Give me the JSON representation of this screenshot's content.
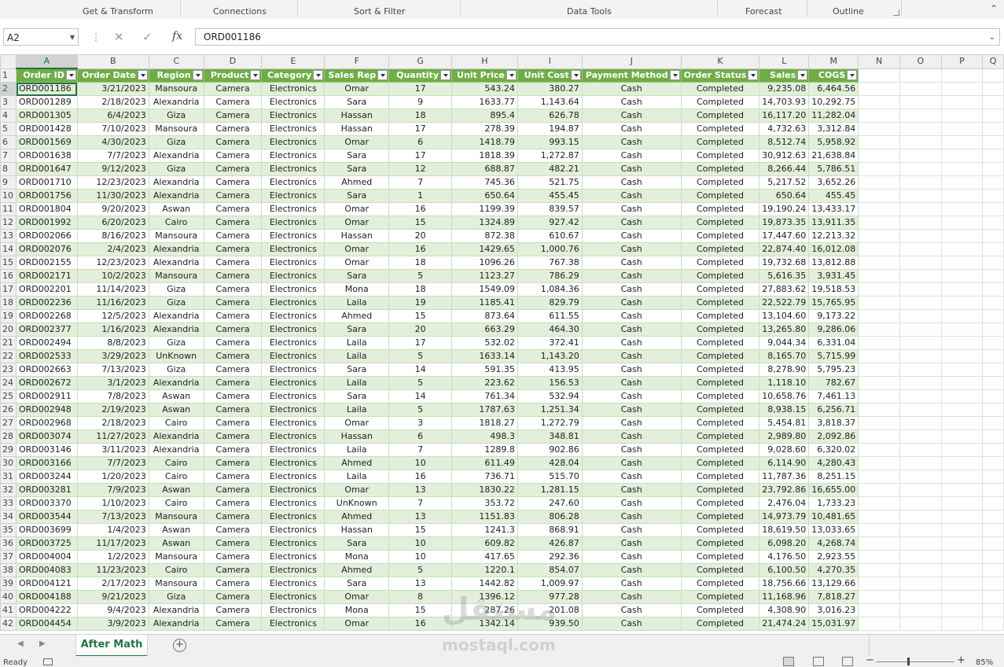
{
  "ribbon": {
    "groups": [
      "Get & Transform",
      "Connections",
      "Sort & Filter",
      "Data Tools",
      "Forecast",
      "Outline"
    ]
  },
  "formula_bar": {
    "name_box": "A2",
    "cancel_icon": "✕",
    "enter_icon": "✓",
    "fx_label": "fx",
    "formula": "ORD001186"
  },
  "columns": [
    "A",
    "B",
    "C",
    "D",
    "E",
    "F",
    "G",
    "H",
    "I",
    "J",
    "K",
    "L",
    "M",
    "N",
    "O",
    "P",
    "Q"
  ],
  "headers": [
    "Order ID",
    "Order Date",
    "Region",
    "Product",
    "Category",
    "Sales Rep",
    "Quantity",
    "Unit Price",
    "Unit Cost",
    "Payment Method",
    "Order Status",
    "Sales",
    "COGS"
  ],
  "rows": [
    [
      "2",
      "ORD001186",
      "3/21/2023",
      "Mansoura",
      "Camera",
      "Electronics",
      "Omar",
      "17",
      "543.24",
      "380.27",
      "Cash",
      "Completed",
      "9,235.08",
      "6,464.56"
    ],
    [
      "3",
      "ORD001289",
      "2/18/2023",
      "Alexandria",
      "Camera",
      "Electronics",
      "Sara",
      "9",
      "1633.77",
      "1,143.64",
      "Cash",
      "Completed",
      "14,703.93",
      "10,292.75"
    ],
    [
      "4",
      "ORD001305",
      "6/4/2023",
      "Giza",
      "Camera",
      "Electronics",
      "Hassan",
      "18",
      "895.4",
      "626.78",
      "Cash",
      "Completed",
      "16,117.20",
      "11,282.04"
    ],
    [
      "5",
      "ORD001428",
      "7/10/2023",
      "Mansoura",
      "Camera",
      "Electronics",
      "Hassan",
      "17",
      "278.39",
      "194.87",
      "Cash",
      "Completed",
      "4,732.63",
      "3,312.84"
    ],
    [
      "6",
      "ORD001569",
      "4/30/2023",
      "Giza",
      "Camera",
      "Electronics",
      "Omar",
      "6",
      "1418.79",
      "993.15",
      "Cash",
      "Completed",
      "8,512.74",
      "5,958.92"
    ],
    [
      "7",
      "ORD001638",
      "7/7/2023",
      "Alexandria",
      "Camera",
      "Electronics",
      "Sara",
      "17",
      "1818.39",
      "1,272.87",
      "Cash",
      "Completed",
      "30,912.63",
      "21,638.84"
    ],
    [
      "8",
      "ORD001647",
      "9/12/2023",
      "Giza",
      "Camera",
      "Electronics",
      "Sara",
      "12",
      "688.87",
      "482.21",
      "Cash",
      "Completed",
      "8,266.44",
      "5,786.51"
    ],
    [
      "9",
      "ORD001710",
      "12/23/2023",
      "Alexandria",
      "Camera",
      "Electronics",
      "Ahmed",
      "7",
      "745.36",
      "521.75",
      "Cash",
      "Completed",
      "5,217.52",
      "3,652.26"
    ],
    [
      "10",
      "ORD001756",
      "11/30/2023",
      "Alexandria",
      "Camera",
      "Electronics",
      "Sara",
      "1",
      "650.64",
      "455.45",
      "Cash",
      "Completed",
      "650.64",
      "455.45"
    ],
    [
      "11",
      "ORD001804",
      "9/20/2023",
      "Aswan",
      "Camera",
      "Electronics",
      "Omar",
      "16",
      "1199.39",
      "839.57",
      "Cash",
      "Completed",
      "19,190.24",
      "13,433.17"
    ],
    [
      "12",
      "ORD001992",
      "6/20/2023",
      "Cairo",
      "Camera",
      "Electronics",
      "Omar",
      "15",
      "1324.89",
      "927.42",
      "Cash",
      "Completed",
      "19,873.35",
      "13,911.35"
    ],
    [
      "13",
      "ORD002066",
      "8/16/2023",
      "Mansoura",
      "Camera",
      "Electronics",
      "Hassan",
      "20",
      "872.38",
      "610.67",
      "Cash",
      "Completed",
      "17,447.60",
      "12,213.32"
    ],
    [
      "14",
      "ORD002076",
      "2/4/2023",
      "Alexandria",
      "Camera",
      "Electronics",
      "Omar",
      "16",
      "1429.65",
      "1,000.76",
      "Cash",
      "Completed",
      "22,874.40",
      "16,012.08"
    ],
    [
      "15",
      "ORD002155",
      "12/23/2023",
      "Alexandria",
      "Camera",
      "Electronics",
      "Omar",
      "18",
      "1096.26",
      "767.38",
      "Cash",
      "Completed",
      "19,732.68",
      "13,812.88"
    ],
    [
      "16",
      "ORD002171",
      "10/2/2023",
      "Mansoura",
      "Camera",
      "Electronics",
      "Sara",
      "5",
      "1123.27",
      "786.29",
      "Cash",
      "Completed",
      "5,616.35",
      "3,931.45"
    ],
    [
      "17",
      "ORD002201",
      "11/14/2023",
      "Giza",
      "Camera",
      "Electronics",
      "Mona",
      "18",
      "1549.09",
      "1,084.36",
      "Cash",
      "Completed",
      "27,883.62",
      "19,518.53"
    ],
    [
      "18",
      "ORD002236",
      "11/16/2023",
      "Giza",
      "Camera",
      "Electronics",
      "Laila",
      "19",
      "1185.41",
      "829.79",
      "Cash",
      "Completed",
      "22,522.79",
      "15,765.95"
    ],
    [
      "19",
      "ORD002268",
      "12/5/2023",
      "Alexandria",
      "Camera",
      "Electronics",
      "Ahmed",
      "15",
      "873.64",
      "611.55",
      "Cash",
      "Completed",
      "13,104.60",
      "9,173.22"
    ],
    [
      "20",
      "ORD002377",
      "1/16/2023",
      "Alexandria",
      "Camera",
      "Electronics",
      "Sara",
      "20",
      "663.29",
      "464.30",
      "Cash",
      "Completed",
      "13,265.80",
      "9,286.06"
    ],
    [
      "21",
      "ORD002494",
      "8/8/2023",
      "Giza",
      "Camera",
      "Electronics",
      "Laila",
      "17",
      "532.02",
      "372.41",
      "Cash",
      "Completed",
      "9,044.34",
      "6,331.04"
    ],
    [
      "22",
      "ORD002533",
      "3/29/2023",
      "UnKnown",
      "Camera",
      "Electronics",
      "Laila",
      "5",
      "1633.14",
      "1,143.20",
      "Cash",
      "Completed",
      "8,165.70",
      "5,715.99"
    ],
    [
      "23",
      "ORD002663",
      "7/13/2023",
      "Giza",
      "Camera",
      "Electronics",
      "Sara",
      "14",
      "591.35",
      "413.95",
      "Cash",
      "Completed",
      "8,278.90",
      "5,795.23"
    ],
    [
      "24",
      "ORD002672",
      "3/1/2023",
      "Alexandria",
      "Camera",
      "Electronics",
      "Laila",
      "5",
      "223.62",
      "156.53",
      "Cash",
      "Completed",
      "1,118.10",
      "782.67"
    ],
    [
      "25",
      "ORD002911",
      "7/8/2023",
      "Aswan",
      "Camera",
      "Electronics",
      "Sara",
      "14",
      "761.34",
      "532.94",
      "Cash",
      "Completed",
      "10,658.76",
      "7,461.13"
    ],
    [
      "26",
      "ORD002948",
      "2/19/2023",
      "Aswan",
      "Camera",
      "Electronics",
      "Laila",
      "5",
      "1787.63",
      "1,251.34",
      "Cash",
      "Completed",
      "8,938.15",
      "6,256.71"
    ],
    [
      "27",
      "ORD002968",
      "2/18/2023",
      "Cairo",
      "Camera",
      "Electronics",
      "Omar",
      "3",
      "1818.27",
      "1,272.79",
      "Cash",
      "Completed",
      "5,454.81",
      "3,818.37"
    ],
    [
      "28",
      "ORD003074",
      "11/27/2023",
      "Alexandria",
      "Camera",
      "Electronics",
      "Hassan",
      "6",
      "498.3",
      "348.81",
      "Cash",
      "Completed",
      "2,989.80",
      "2,092.86"
    ],
    [
      "29",
      "ORD003146",
      "3/11/2023",
      "Alexandria",
      "Camera",
      "Electronics",
      "Laila",
      "7",
      "1289.8",
      "902.86",
      "Cash",
      "Completed",
      "9,028.60",
      "6,320.02"
    ],
    [
      "30",
      "ORD003166",
      "7/7/2023",
      "Cairo",
      "Camera",
      "Electronics",
      "Ahmed",
      "10",
      "611.49",
      "428.04",
      "Cash",
      "Completed",
      "6,114.90",
      "4,280.43"
    ],
    [
      "31",
      "ORD003244",
      "1/20/2023",
      "Cairo",
      "Camera",
      "Electronics",
      "Laila",
      "16",
      "736.71",
      "515.70",
      "Cash",
      "Completed",
      "11,787.36",
      "8,251.15"
    ],
    [
      "32",
      "ORD003281",
      "7/9/2023",
      "Aswan",
      "Camera",
      "Electronics",
      "Omar",
      "13",
      "1830.22",
      "1,281.15",
      "Cash",
      "Completed",
      "23,792.86",
      "16,655.00"
    ],
    [
      "33",
      "ORD003370",
      "1/10/2023",
      "Cairo",
      "Camera",
      "Electronics",
      "UnKnown",
      "7",
      "353.72",
      "247.60",
      "Cash",
      "Completed",
      "2,476.04",
      "1,733.23"
    ],
    [
      "34",
      "ORD003544",
      "7/13/2023",
      "Mansoura",
      "Camera",
      "Electronics",
      "Ahmed",
      "13",
      "1151.83",
      "806.28",
      "Cash",
      "Completed",
      "14,973.79",
      "10,481.65"
    ],
    [
      "35",
      "ORD003699",
      "1/4/2023",
      "Aswan",
      "Camera",
      "Electronics",
      "Hassan",
      "15",
      "1241.3",
      "868.91",
      "Cash",
      "Completed",
      "18,619.50",
      "13,033.65"
    ],
    [
      "36",
      "ORD003725",
      "11/17/2023",
      "Aswan",
      "Camera",
      "Electronics",
      "Sara",
      "10",
      "609.82",
      "426.87",
      "Cash",
      "Completed",
      "6,098.20",
      "4,268.74"
    ],
    [
      "37",
      "ORD004004",
      "1/2/2023",
      "Mansoura",
      "Camera",
      "Electronics",
      "Mona",
      "10",
      "417.65",
      "292.36",
      "Cash",
      "Completed",
      "4,176.50",
      "2,923.55"
    ],
    [
      "38",
      "ORD004083",
      "11/23/2023",
      "Cairo",
      "Camera",
      "Electronics",
      "Ahmed",
      "5",
      "1220.1",
      "854.07",
      "Cash",
      "Completed",
      "6,100.50",
      "4,270.35"
    ],
    [
      "39",
      "ORD004121",
      "2/17/2023",
      "Mansoura",
      "Camera",
      "Electronics",
      "Sara",
      "13",
      "1442.82",
      "1,009.97",
      "Cash",
      "Completed",
      "18,756.66",
      "13,129.66"
    ],
    [
      "40",
      "ORD004188",
      "9/21/2023",
      "Giza",
      "Camera",
      "Electronics",
      "Omar",
      "8",
      "1396.12",
      "977.28",
      "Cash",
      "Completed",
      "11,168.96",
      "7,818.27"
    ],
    [
      "41",
      "ORD004222",
      "9/4/2023",
      "Alexandria",
      "Camera",
      "Electronics",
      "Mona",
      "15",
      "287.26",
      "201.08",
      "Cash",
      "Completed",
      "4,308.90",
      "3,016.23"
    ],
    [
      "42",
      "ORD004454",
      "3/9/2023",
      "Alexandria",
      "Camera",
      "Electronics",
      "Omar",
      "16",
      "1342.14",
      "939.50",
      "Cash",
      "Completed",
      "21,474.24",
      "15,031.97"
    ]
  ],
  "sheet_tabs": {
    "active": "After Math",
    "add": "+"
  },
  "status": {
    "ready": "Ready",
    "zoom": "85%"
  },
  "watermark": {
    "text": "mostaql.com",
    "logo": "مستقل"
  },
  "colors": {
    "header_green": "#70ad47",
    "band_green": "#e2efda",
    "accent": "#217346"
  }
}
